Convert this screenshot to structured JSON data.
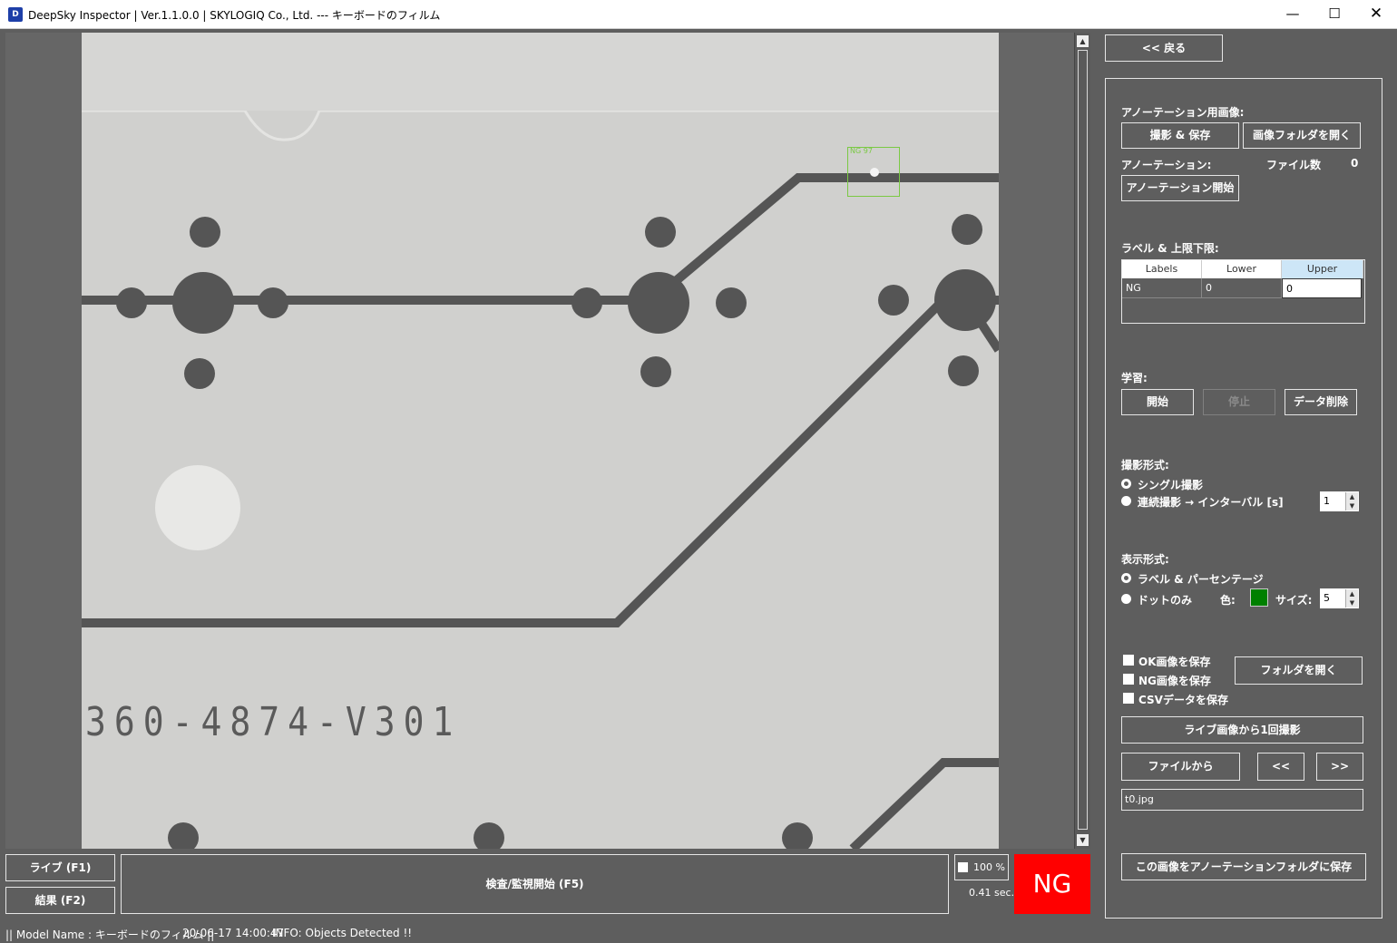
{
  "window": {
    "title": "DeepSky Inspector | Ver.1.1.0.0 | SKYLOGIQ Co., Ltd. --- キーボードのフィルム",
    "icon": "app-logo-icon",
    "minimize": "—",
    "maximize": "☐",
    "close": "✕"
  },
  "viewer": {
    "serial_text": "360-4874-V301",
    "detection_label": "NG 97",
    "scroll_up": "▲",
    "scroll_down": "▼"
  },
  "bottom": {
    "live_label": "ライブ (F1)",
    "result_label": "結果 (F2)",
    "inspect_label": "検査/監視開始 (F5)",
    "zoom_text": "100 %",
    "time_text": "0.41 sec.",
    "judgement": "NG",
    "judgement_color": "#ff0000"
  },
  "status": {
    "model": "|| Model Name : キーボードのフィルム ||",
    "time": "20-06-17 14:00:47",
    "info": "INFO:   Objects Detected !!"
  },
  "panel": {
    "back_label": "<< 戻る",
    "annotation_image_heading": "アノーテーション用画像:",
    "capture_save_label": "撮影 & 保存",
    "open_image_folder_label": "画像フォルダを開く",
    "annotation_heading": "アノーテーション:",
    "file_count_label": "ファイル数",
    "file_count_value": "0",
    "start_annotation_label": "アノーテーション開始",
    "labels_heading": "ラベル & 上限下限:",
    "table": {
      "headers": [
        "Labels",
        "Lower",
        "Upper"
      ],
      "rows": [
        [
          "NG",
          "0",
          "0"
        ]
      ]
    },
    "learning_heading": "学習:",
    "learn_start_label": "開始",
    "learn_stop_label": "停止",
    "delete_data_label": "データ削除",
    "capture_mode_heading": "撮影形式:",
    "single_capture_label": "シングル撮影",
    "continuous_capture_label": "連続撮影 → インターバル [s]",
    "interval_value": "1",
    "display_mode_heading": "表示形式:",
    "label_percentage_label": "ラベル & パーセンテージ",
    "dot_only_label": "ドットのみ",
    "color_label": "色:",
    "dot_color": "#008000",
    "size_label": "サイズ:",
    "size_value": "5",
    "save_ok_label": "OK画像を保存",
    "save_ng_label": "NG画像を保存",
    "save_csv_label": "CSVデータを保存",
    "open_folder_label": "フォルダを開く",
    "capture_once_label": "ライブ画像から1回撮影",
    "from_file_label": "ファイルから",
    "prev_label": "<<",
    "next_label": ">>",
    "filename_value": "t0.jpg",
    "save_to_annotation_label": "この画像をアノーテーションフォルダに保存"
  }
}
